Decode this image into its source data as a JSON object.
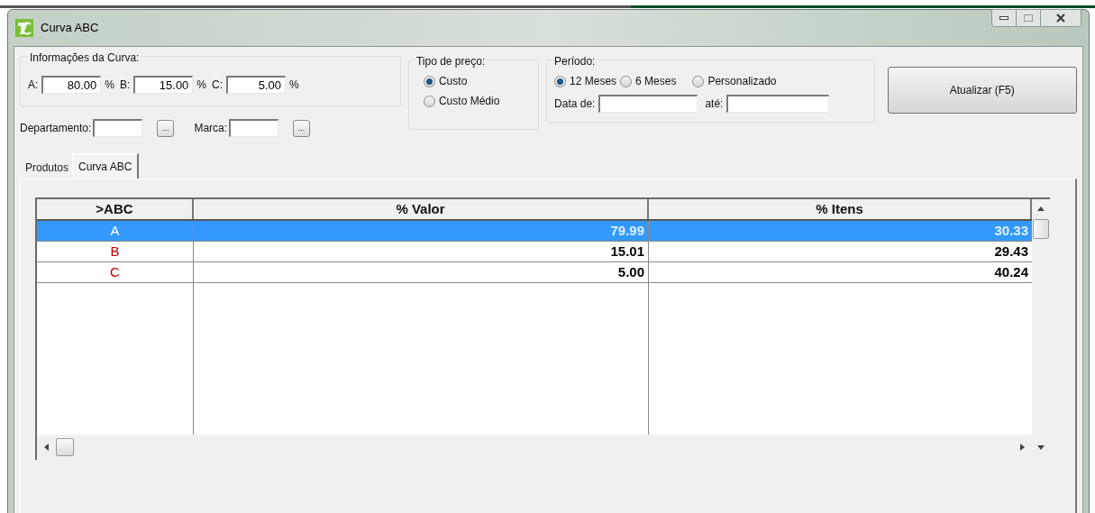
{
  "window": {
    "title": "Curva ABC"
  },
  "curve_info": {
    "label": "Informações da Curva:",
    "fields": [
      {
        "label": "A:",
        "value": "80.00",
        "unit": "%"
      },
      {
        "label": "B:",
        "value": "15.00",
        "unit": "%"
      },
      {
        "label": "C:",
        "value": "5.00",
        "unit": "%"
      }
    ]
  },
  "filters": [
    {
      "label": "Departamento:",
      "button": "..."
    },
    {
      "label": "Marca:",
      "button": "..."
    }
  ],
  "price_type": {
    "label": "Tipo de preço:",
    "options": [
      {
        "label": "Custo",
        "selected": true
      },
      {
        "label": "Custo Médio",
        "selected": false
      }
    ]
  },
  "period": {
    "label": "Período:",
    "options": [
      {
        "label": "12 Meses",
        "selected": true
      },
      {
        "label": "6 Meses",
        "selected": false
      },
      {
        "label": "Personalizado",
        "selected": false
      }
    ],
    "date_from_label": "Data de:",
    "date_to_label": "até:"
  },
  "refresh_button": "Atualizar (F5)",
  "tabs": [
    {
      "label": "Produtos",
      "selected": false
    },
    {
      "label": "Curva ABC",
      "selected": true
    }
  ],
  "table": {
    "columns": [
      ">ABC",
      "% Valor",
      "% Itens"
    ],
    "rows": [
      {
        "class": "A",
        "value": "79.99",
        "items": "30.33",
        "selected": true
      },
      {
        "class": "B",
        "value": "15.01",
        "items": "29.43",
        "selected": false
      },
      {
        "class": "C",
        "value": "5.00",
        "items": "40.24",
        "selected": false
      }
    ]
  }
}
